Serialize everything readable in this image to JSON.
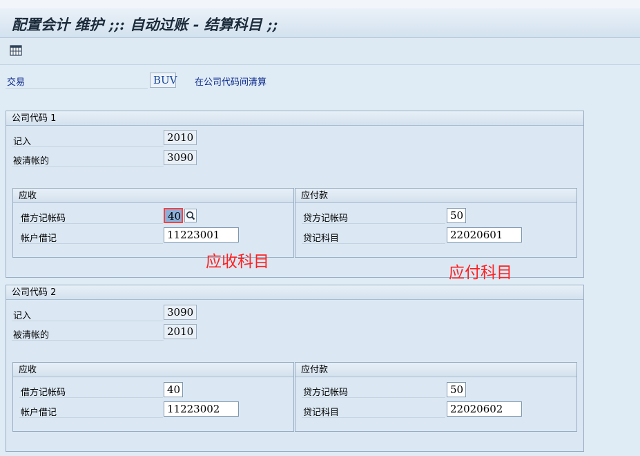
{
  "window": {
    "title": "配置会计 维护 ;;: 自动过账 - 结算科目 ;;"
  },
  "toolbar": {
    "table_icon": "table-settings-icon"
  },
  "header": {
    "transaction_label": "交易",
    "transaction_value": "BUV",
    "transaction_desc": "在公司代码间清算"
  },
  "company1": {
    "title": "公司代码 1",
    "posted_label": "记入",
    "posted_value": "2010",
    "cleared_label": "被清帐的",
    "cleared_value": "3090",
    "receivable": {
      "title": "应收",
      "debit_key_label": "借方记帐码",
      "debit_key_value": "40",
      "account_label": "帐户借记",
      "account_value": "11223001"
    },
    "payable": {
      "title": "应付款",
      "credit_key_label": "贷方记帐码",
      "credit_key_value": "50",
      "account_label": "贷记科目",
      "account_value": "22020601"
    }
  },
  "company2": {
    "title": "公司代码 2",
    "posted_label": "记入",
    "posted_value": "3090",
    "cleared_label": "被清帐的",
    "cleared_value": "2010",
    "receivable": {
      "title": "应收",
      "debit_key_label": "借方记帐码",
      "debit_key_value": "40",
      "account_label": "帐户借记",
      "account_value": "11223002"
    },
    "payable": {
      "title": "应付款",
      "credit_key_label": "贷方记帐码",
      "credit_key_value": "50",
      "account_label": "贷记科目",
      "account_value": "22020602"
    }
  },
  "annotations": {
    "receivable_note": "应收科目",
    "payable_note": "应付科目",
    "color": "#ff2020"
  }
}
